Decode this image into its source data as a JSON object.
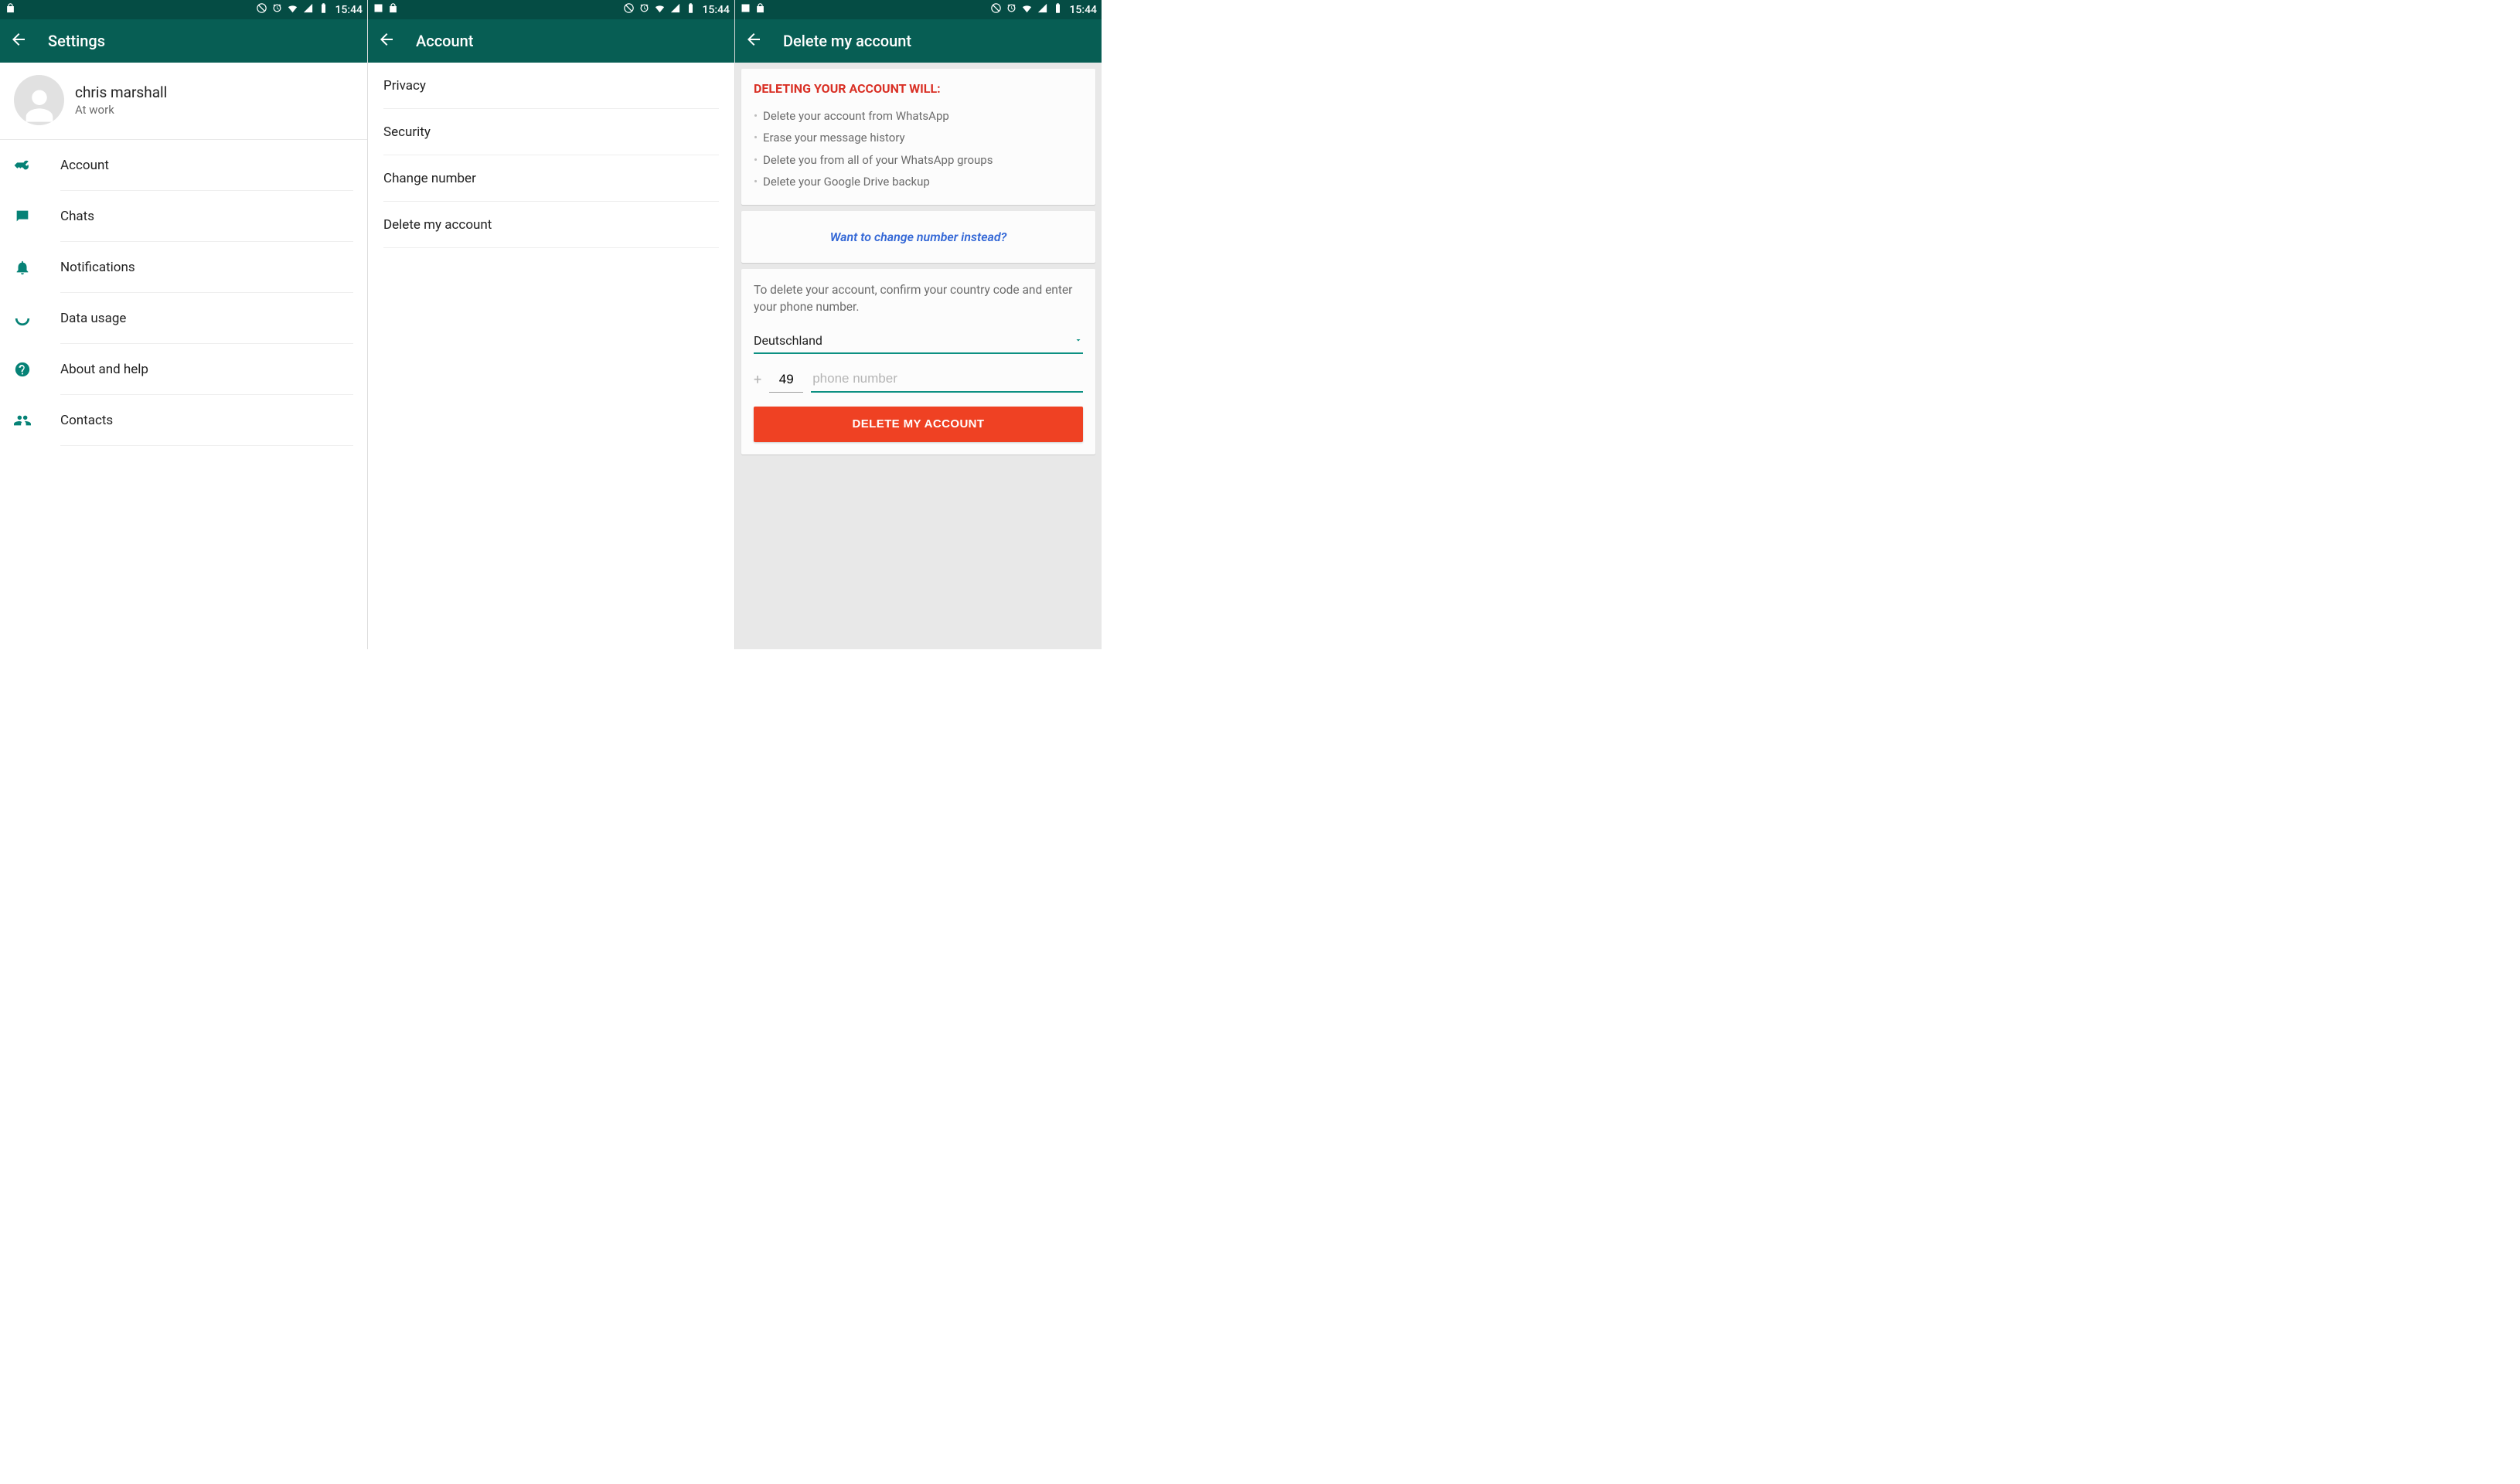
{
  "status": {
    "time": "15:44"
  },
  "screen1": {
    "title": "Settings",
    "profile": {
      "name": "chris marshall",
      "status": "At work"
    },
    "items": [
      {
        "label": "Account"
      },
      {
        "label": "Chats"
      },
      {
        "label": "Notifications"
      },
      {
        "label": "Data usage"
      },
      {
        "label": "About and help"
      },
      {
        "label": "Contacts"
      }
    ]
  },
  "screen2": {
    "title": "Account",
    "items": [
      {
        "label": "Privacy"
      },
      {
        "label": "Security"
      },
      {
        "label": "Change number"
      },
      {
        "label": "Delete my account"
      }
    ]
  },
  "screen3": {
    "title": "Delete my account",
    "warn_title": "DELETING YOUR ACCOUNT WILL:",
    "warn_items": [
      "Delete your account from WhatsApp",
      "Erase your message history",
      "Delete you from all of your WhatsApp groups",
      "Delete your Google Drive backup"
    ],
    "change_link": "Want to change number instead?",
    "confirm_text": "To delete your account, confirm your country code and enter your phone number.",
    "country": "Deutschland",
    "country_code": "49",
    "phone_placeholder": "phone number",
    "delete_button": "DELETE MY ACCOUNT"
  }
}
